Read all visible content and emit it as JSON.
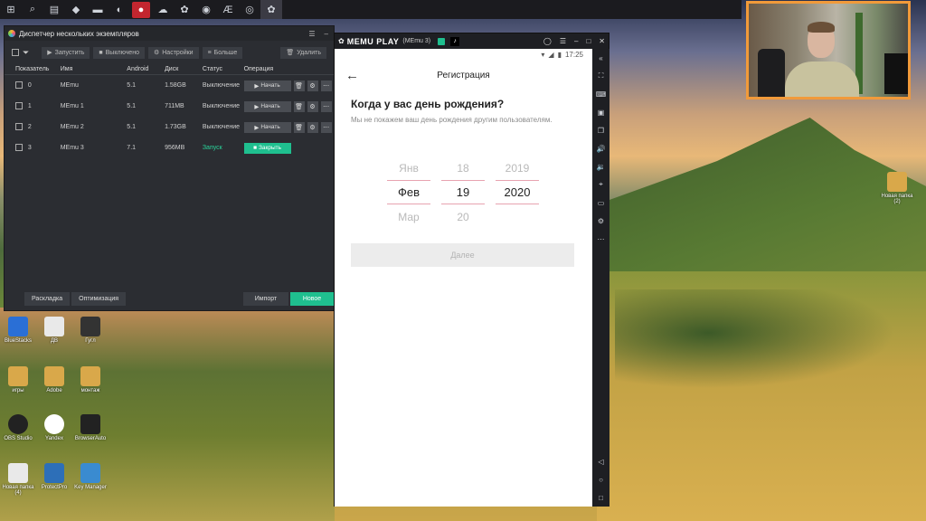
{
  "manager": {
    "title": "Диспетчер нескольких экземпляров",
    "toolbar": {
      "start": "Запустить",
      "off": "Выключено",
      "settings": "Настройки",
      "more": "Больше",
      "delete": "Удалить"
    },
    "headers": [
      "Показатель",
      "Имя",
      "Android",
      "Диск",
      "Статус",
      "Операция"
    ],
    "rows": [
      {
        "idx": "0",
        "name": "MEmu",
        "android": "5.1",
        "disk": "1.58GB",
        "status": "Выключение",
        "op": "Начать"
      },
      {
        "idx": "1",
        "name": "MEmu 1",
        "android": "5.1",
        "disk": "711MB",
        "status": "Выключение",
        "op": "Начать"
      },
      {
        "idx": "2",
        "name": "MEmu 2",
        "android": "5.1",
        "disk": "1.73GB",
        "status": "Выключение",
        "op": "Начать"
      },
      {
        "idx": "3",
        "name": "MEmu 3",
        "android": "7.1",
        "disk": "956MB",
        "status": "Запуск",
        "op": "Закрыть"
      }
    ],
    "bottom": {
      "layout": "Раскладка",
      "optimize": "Оптимизация",
      "import": "Импорт",
      "new": "Новое"
    }
  },
  "memu": {
    "brand": "MEMU PLAY",
    "instance": "(MEmu 3)",
    "time": "17:25",
    "screen": {
      "title": "Регистрация",
      "question": "Когда у вас день рождения?",
      "subtitle": "Мы не покажем ваш день рождения другим пользователям.",
      "months": [
        "Янв",
        "Фев",
        "Мар"
      ],
      "days": [
        "18",
        "19",
        "20"
      ],
      "years": [
        "2019",
        "2020",
        ""
      ],
      "next": "Далее"
    }
  },
  "desktop": {
    "icons": [
      {
        "label": "BlueStacks",
        "color": "#2a6fd6"
      },
      {
        "label": "ДВ",
        "color": "#e9e9e9"
      },
      {
        "label": "Гугл",
        "color": "#333"
      },
      {
        "label": "игры",
        "color": "#d9a84a"
      },
      {
        "label": "Adobe",
        "color": "#d9a84a"
      },
      {
        "label": "монтаж",
        "color": "#d9a84a"
      },
      {
        "label": "OBS Studio",
        "color": "#222"
      },
      {
        "label": "Yandex",
        "color": "#fff"
      },
      {
        "label": "BrowserAuto",
        "color": "#222"
      },
      {
        "label": "Новая папка (4)",
        "color": "#e9e9e9"
      },
      {
        "label": "ProtectPro",
        "color": "#2d6fb8"
      },
      {
        "label": "Key Manager",
        "color": "#3a8bd0"
      }
    ],
    "right_icon": "Новая папка (2)"
  }
}
